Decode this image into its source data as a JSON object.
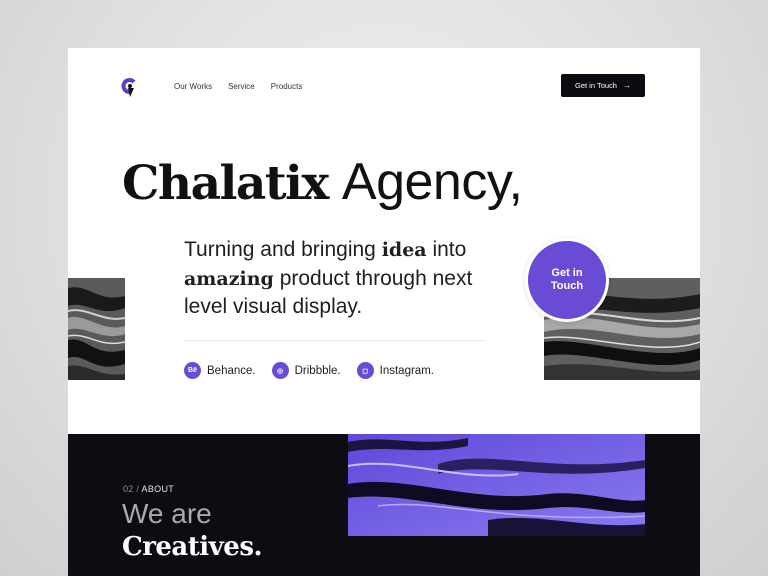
{
  "nav": {
    "links": [
      "Our Works",
      "Service",
      "Products"
    ],
    "cta_label": "Get in Touch",
    "cta_arrow": "→"
  },
  "hero": {
    "title_bold": "Chalatix",
    "title_rest": "Agency,",
    "lead_1": "Turning and bringing",
    "lead_bold_1": "idea",
    "lead_2": "into",
    "lead_bold_2": "amazing",
    "lead_3": "product through next level visual display.",
    "circle_cta": "Get in Touch",
    "social": [
      {
        "icon": "behance-icon",
        "glyph": "Bē",
        "label": "Behance."
      },
      {
        "icon": "dribbble-icon",
        "glyph": "◎",
        "label": "Dribbble."
      },
      {
        "icon": "instagram-icon",
        "glyph": "◻",
        "label": "Instagram."
      }
    ]
  },
  "about": {
    "number": "02 /",
    "kicker": "ABOUT",
    "line1": "We are",
    "line2": "Creatives."
  },
  "colors": {
    "accent": "#6a4bd6",
    "dark": "#0d0c13",
    "text": "#111111"
  }
}
